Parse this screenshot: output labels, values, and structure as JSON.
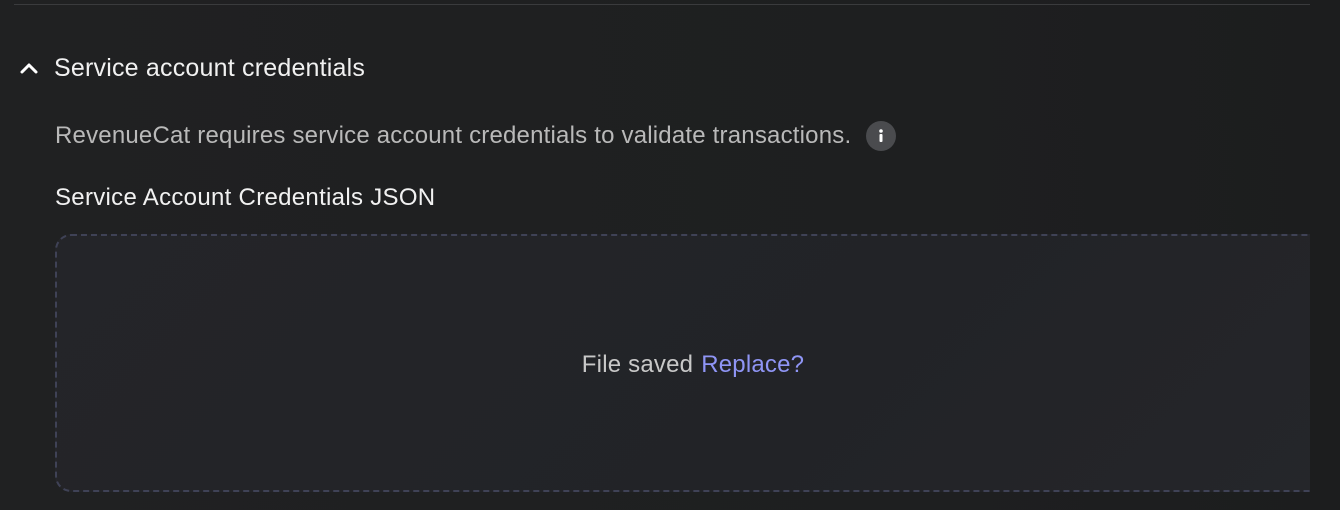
{
  "section": {
    "title": "Service account credentials",
    "expanded": true,
    "description": "RevenueCat requires service account credentials to validate transactions.",
    "info_icon": "info-icon",
    "toggle_icon": "chevron-up-icon"
  },
  "field": {
    "label": "Service Account Credentials JSON"
  },
  "dropzone": {
    "status_text": "File saved",
    "action_text": "Replace?"
  },
  "colors": {
    "background": "#1f2021",
    "text_primary": "#f1f1f1",
    "text_secondary": "#b9b9b9",
    "link": "#8f95f5",
    "dropzone_border": "#3f4256"
  }
}
